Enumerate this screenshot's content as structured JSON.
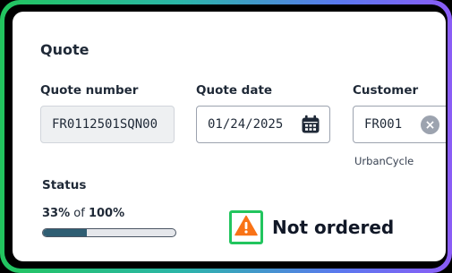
{
  "card": {
    "title": "Quote"
  },
  "quote_number": {
    "label": "Quote number",
    "value": "FR0112501SQN00"
  },
  "quote_date": {
    "label": "Quote date",
    "value": "01/24/2025"
  },
  "customer": {
    "label": "Customer",
    "value": "FR001",
    "name": "UrbanCycle"
  },
  "status": {
    "label": "Status",
    "progress_percent": 33,
    "progress_value": "33%",
    "progress_of": "of",
    "progress_total": "100%",
    "text": "Not ordered"
  },
  "colors": {
    "progress_fill": "#2f5e73",
    "warning": "#f97316",
    "highlight_border": "#22c55e"
  },
  "icons": [
    "calendar-icon",
    "clear-icon",
    "warning-icon"
  ]
}
